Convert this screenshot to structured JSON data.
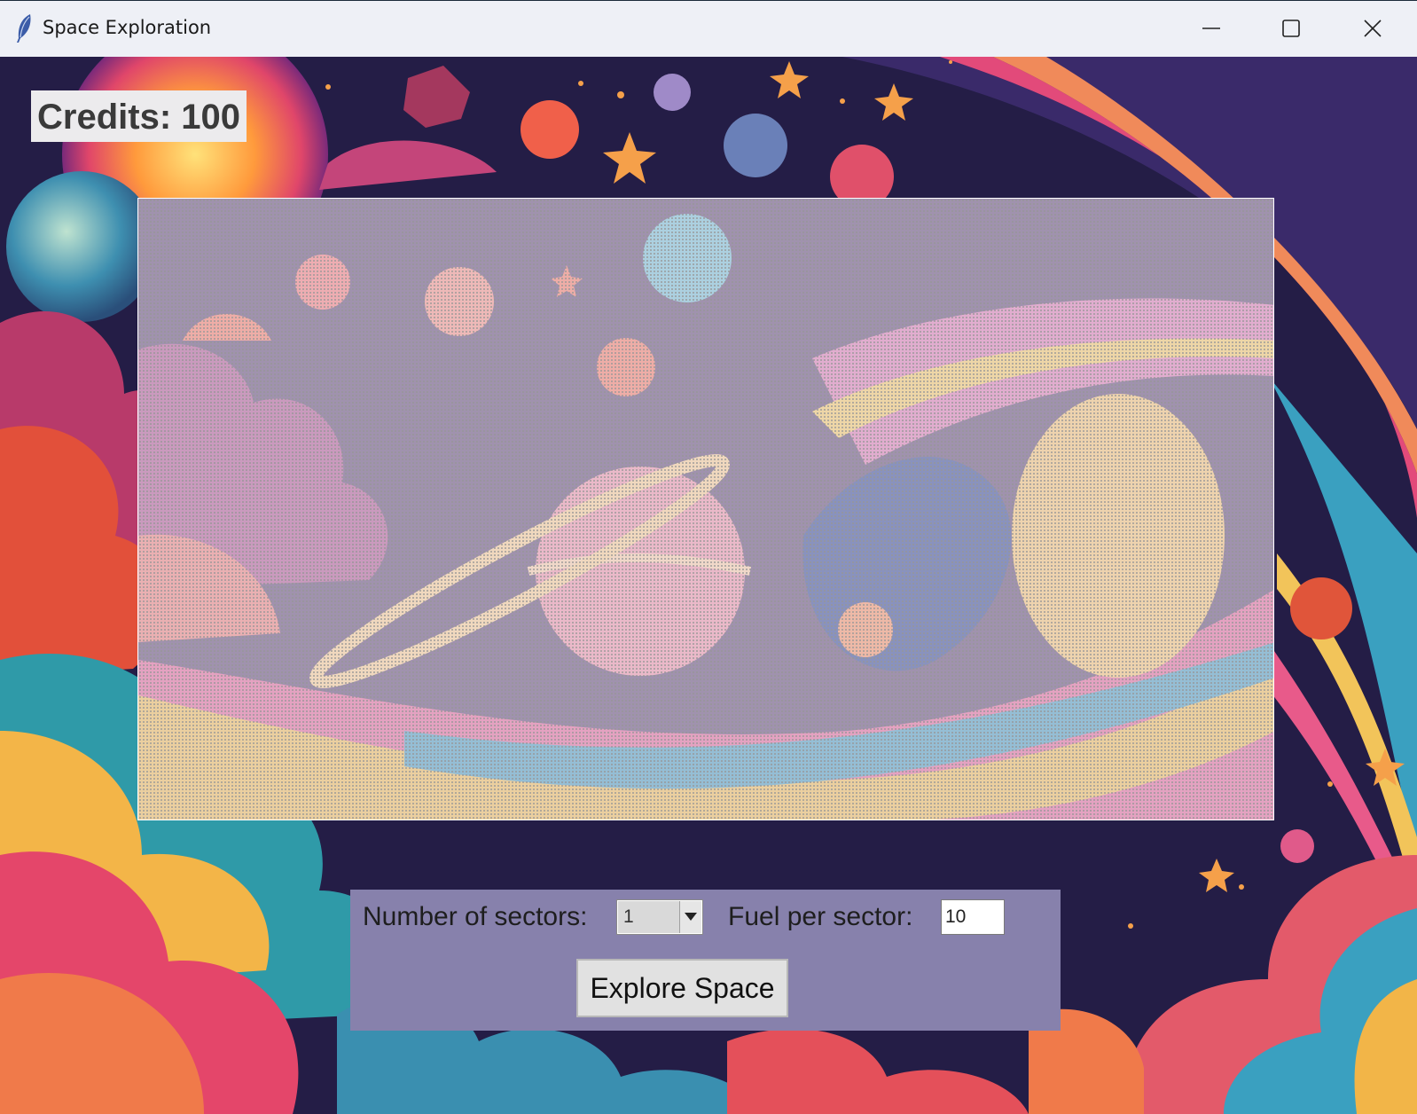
{
  "window": {
    "title": "Space Exploration",
    "controls": [
      "minimize-icon",
      "maximize-icon",
      "close-icon"
    ]
  },
  "status": {
    "credits_label": "Credits: 100"
  },
  "controls": {
    "sectors_label": "Number of sectors:",
    "sectors_value": "1",
    "fuel_label": "Fuel per sector:",
    "fuel_value": "10",
    "explore_label": "Explore Space"
  },
  "colors": {
    "panel": "#8781ac",
    "titlebar": "#eef0f6",
    "credits_bg": "#ecebed"
  }
}
